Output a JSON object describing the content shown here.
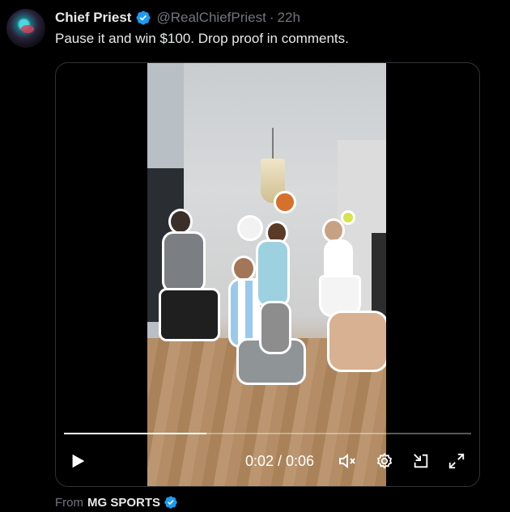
{
  "post": {
    "author_name": "Chief Priest",
    "handle": "@RealChiefPriest",
    "separator": "·",
    "timestamp": "22h",
    "text": "Pause it and win $100. Drop proof in comments."
  },
  "video": {
    "current_time": "0:02",
    "duration": "0:06",
    "time_display": "0:02 / 0:06",
    "progress_fraction": 0.35
  },
  "footer": {
    "from_label": "From",
    "source_name": "MG SPORTS"
  },
  "colors": {
    "verified_badge": "#1d9bf0",
    "muted_text": "#71767b",
    "border": "#2f3336"
  },
  "icons": [
    "verified-badge-icon",
    "play-icon",
    "volume-icon",
    "settings-icon",
    "exit-docked-icon",
    "fullscreen-icon"
  ]
}
